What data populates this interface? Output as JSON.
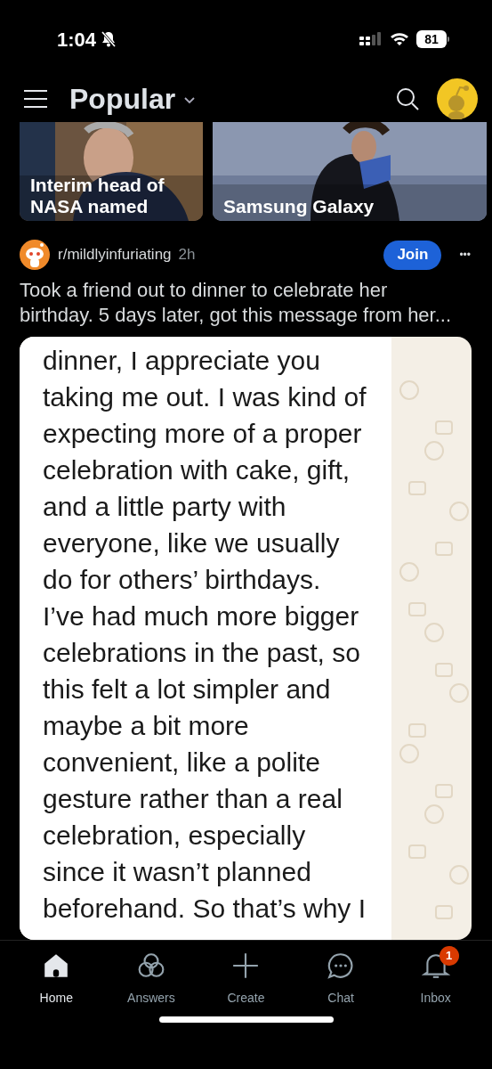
{
  "status_bar": {
    "time": "1:04",
    "silent": true,
    "battery": "81"
  },
  "header": {
    "title": "Popular"
  },
  "carousel": [
    {
      "caption": "Interim head of NASA named",
      "kind": "picture"
    },
    {
      "caption": "Samsung Galaxy",
      "kind": "picture"
    }
  ],
  "post": {
    "community": "r/mildlyinfuriating",
    "age": "2h",
    "join_label": "Join",
    "more": "•••",
    "title": "Took a friend out to dinner to celebrate her birthday. 5 days later, got this message from her...",
    "message_lines": [
      "dinner, I appreciate you",
      "taking me out. I was kind of",
      "expecting more of a proper",
      "celebration with cake, gift,",
      "and a little party with",
      "everyone, like we usually",
      "do for others’ birthdays.",
      "I’ve had much more bigger",
      "celebrations in the past, so",
      "this felt a lot simpler and",
      "maybe a bit more",
      "convenient, like a polite",
      "gesture rather than a real",
      "celebration, especially",
      "since it wasn’t planned",
      "beforehand. So that’s why I"
    ]
  },
  "bottom_nav": [
    {
      "label": "Home",
      "selected": true
    },
    {
      "label": "Answers",
      "selected": false
    },
    {
      "label": "Create",
      "selected": false
    },
    {
      "label": "Chat",
      "selected": false
    },
    {
      "label": "Inbox",
      "selected": false,
      "badge": "1"
    }
  ]
}
